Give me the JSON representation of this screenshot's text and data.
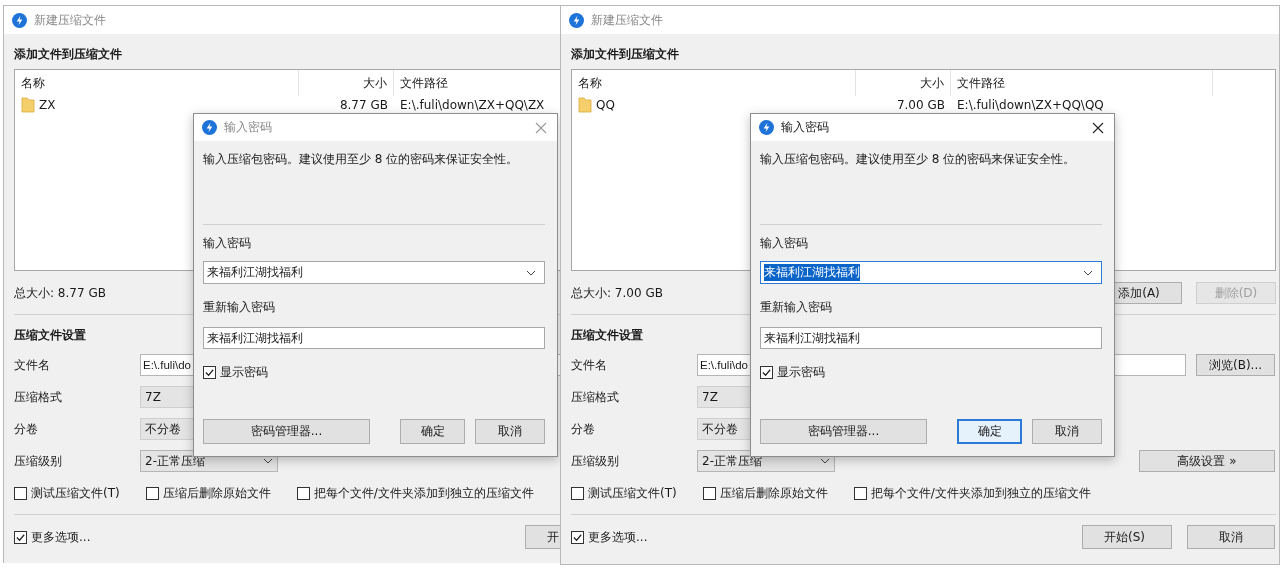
{
  "windows": [
    {
      "title": "新建压缩文件",
      "section_title": "添加文件到压缩文件",
      "columns": [
        "名称",
        "大小",
        "文件路径"
      ],
      "files": [
        {
          "name": "ZX",
          "size": "8.77 GB",
          "path": "E:\\.fuli\\down\\ZX+QQ\\ZX"
        }
      ],
      "total": "总大小: 8.77 GB",
      "settings_title": "压缩文件设置",
      "settings": [
        {
          "label": "文件名",
          "kind": "input",
          "value": "E:\\.fuli\\do"
        },
        {
          "label": "压缩格式",
          "kind": "select",
          "value": "7Z"
        },
        {
          "label": "分卷",
          "kind": "select",
          "value": "不分卷"
        },
        {
          "label": "压缩级别",
          "kind": "dropdown",
          "value": "2-正常压缩"
        }
      ],
      "options": [
        {
          "label": "测试压缩文件(T)",
          "checked": false
        },
        {
          "label": "压缩后删除原始文件",
          "checked": false
        },
        {
          "label": "把每个文件/文件夹添加到独立的压缩文件",
          "checked": false
        }
      ],
      "more_options": {
        "label": "更多选项...",
        "checked": true
      },
      "buttons": [
        {
          "label": "开"
        }
      ],
      "dialog": {
        "title": "输入密码",
        "active": false,
        "message": "输入压缩包密码。建议使用至少 8 位的密码来保证安全性。",
        "password_label": "输入密码",
        "password": "来福利江湖找福利",
        "password_selected": false,
        "confirm_label": "重新输入密码",
        "confirm": "来福利江湖找福利",
        "show_password": {
          "label": "显示密码",
          "checked": true
        },
        "manager_button": "密码管理器...",
        "buttons": [
          {
            "label": "确定",
            "focused": false
          },
          {
            "label": "取消",
            "focused": false
          }
        ]
      }
    },
    {
      "title": "新建压缩文件",
      "section_title": "添加文件到压缩文件",
      "columns": [
        "名称",
        "大小",
        "文件路径"
      ],
      "files": [
        {
          "name": "QQ",
          "size": "7.00 GB",
          "path": "E:\\.fuli\\down\\ZX+QQ\\QQ"
        }
      ],
      "total": "总大小: 7.00 GB",
      "list_buttons": [
        {
          "label": "添加(A)",
          "disabled": false
        },
        {
          "label": "删除(D)",
          "disabled": true
        }
      ],
      "settings_title": "压缩文件设置",
      "settings": [
        {
          "label": "文件名",
          "kind": "input",
          "value": "E:\\.fuli\\do",
          "button": "浏览(B)..."
        },
        {
          "label": "压缩格式",
          "kind": "select",
          "value": "7Z"
        },
        {
          "label": "分卷",
          "kind": "select",
          "value": "不分卷"
        },
        {
          "label": "压缩级别",
          "kind": "dropdown",
          "value": "2-正常压缩",
          "button": "高级设置 »"
        }
      ],
      "options": [
        {
          "label": "测试压缩文件(T)",
          "checked": false
        },
        {
          "label": "压缩后删除原始文件",
          "checked": false
        },
        {
          "label": "把每个文件/文件夹添加到独立的压缩文件",
          "checked": false
        }
      ],
      "more_options": {
        "label": "更多选项...",
        "checked": true
      },
      "buttons": [
        {
          "label": "开始(S)"
        },
        {
          "label": "取消"
        }
      ],
      "dialog": {
        "title": "输入密码",
        "active": true,
        "message": "输入压缩包密码。建议使用至少 8 位的密码来保证安全性。",
        "password_label": "输入密码",
        "password": "来福利江湖找福利",
        "password_selected": true,
        "confirm_label": "重新输入密码",
        "confirm": "来福利江湖找福利",
        "show_password": {
          "label": "显示密码",
          "checked": true
        },
        "manager_button": "密码管理器...",
        "buttons": [
          {
            "label": "确定",
            "focused": true
          },
          {
            "label": "取消",
            "focused": false
          }
        ]
      }
    }
  ]
}
